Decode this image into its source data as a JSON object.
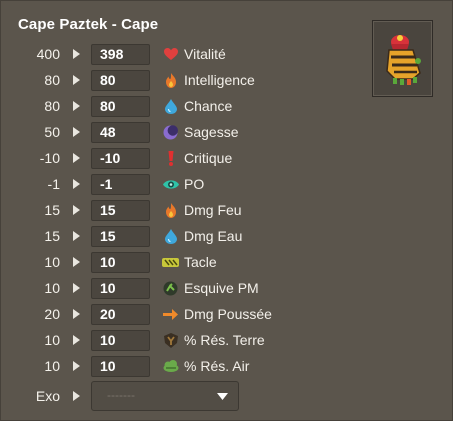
{
  "item": {
    "title": "Cape Paztek - Cape",
    "image_icon": "cape-paztek-image"
  },
  "stats": [
    {
      "base": "400",
      "value": "398",
      "label": "Vitalité",
      "icon": "heart-icon",
      "color": "#e0403e"
    },
    {
      "base": "80",
      "value": "80",
      "label": "Intelligence",
      "icon": "fire-icon",
      "color": "#e8782a"
    },
    {
      "base": "80",
      "value": "80",
      "label": "Chance",
      "icon": "water-drop-icon",
      "color": "#3fa8dc"
    },
    {
      "base": "50",
      "value": "48",
      "label": "Sagesse",
      "icon": "moon-icon",
      "color": "#8a6cd0"
    },
    {
      "base": "-10",
      "value": "-10",
      "label": "Critique",
      "icon": "exclamation-icon",
      "color": "#e03030"
    },
    {
      "base": "-1",
      "value": "-1",
      "label": "PO",
      "icon": "eye-icon",
      "color": "#2fc3a8"
    },
    {
      "base": "15",
      "value": "15",
      "label": "Dmg Feu",
      "icon": "fire-damage-icon",
      "color": "#e8782a"
    },
    {
      "base": "15",
      "value": "15",
      "label": "Dmg Eau",
      "icon": "water-damage-icon",
      "color": "#3fa8dc"
    },
    {
      "base": "10",
      "value": "10",
      "label": "Tacle",
      "icon": "tackle-icon",
      "color": "#c8c83a"
    },
    {
      "base": "10",
      "value": "10",
      "label": "Esquive PM",
      "icon": "dodge-icon",
      "color": "#7cc04a"
    },
    {
      "base": "20",
      "value": "20",
      "label": "Dmg Poussée",
      "icon": "push-arrow-icon",
      "color": "#f08a2a"
    },
    {
      "base": "10",
      "value": "10",
      "label": "% Rés. Terre",
      "icon": "earth-resist-icon",
      "color": "#a0783a"
    },
    {
      "base": "10",
      "value": "10",
      "label": "% Rés. Air",
      "icon": "air-resist-icon",
      "color": "#6aaa4a"
    }
  ],
  "exo": {
    "label": "Exo",
    "placeholder": "-------"
  }
}
